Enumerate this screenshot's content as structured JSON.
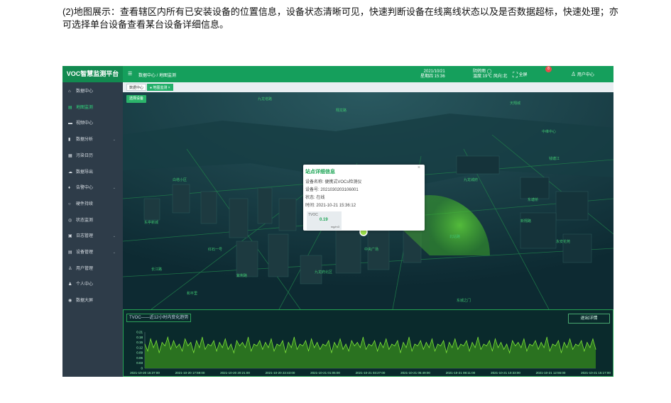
{
  "caption": "(2)地图展示：查看辖区内所有已安装设备的位置信息，设备状态清晰可见，快速判断设备在线离线状态以及是否数据超标，快速处理；亦可选择单台设备查看某台设备详细信息。",
  "app": {
    "title": "VOC智慧监测平台",
    "breadcrumb": "数据中心 / 地图监测",
    "date": "2021/10/21",
    "weekday_time": "星期四 15:36",
    "weather_line1": "阴转雨 ◯",
    "weather_line2": "温度:19℃ 风向:北",
    "fullscreen": "全屏",
    "badge_count": "8",
    "user": "用户中心"
  },
  "sidebar": {
    "items": [
      {
        "label": "数据中心",
        "icon": "home-icon",
        "glyph": "⌂",
        "chevron": ""
      },
      {
        "label": "地图监测",
        "icon": "map-icon",
        "glyph": "▤",
        "chevron": ""
      },
      {
        "label": "视频中心",
        "icon": "video-icon",
        "glyph": "▬",
        "chevron": ""
      },
      {
        "label": "数据分析",
        "icon": "bar-chart-icon",
        "glyph": "▮",
        "chevron": "⌄"
      },
      {
        "label": "污染日历",
        "icon": "calendar-icon",
        "glyph": "▦",
        "chevron": ""
      },
      {
        "label": "数据导出",
        "icon": "export-icon",
        "glyph": "☁",
        "chevron": ""
      },
      {
        "label": "告警中心",
        "icon": "alarm-icon",
        "glyph": "♦",
        "chevron": "⌄"
      },
      {
        "label": "硬件持续",
        "icon": "hardware-icon",
        "glyph": "○",
        "chevron": ""
      },
      {
        "label": "状态监测",
        "icon": "status-icon",
        "glyph": "◎",
        "chevron": ""
      },
      {
        "label": "日志管理",
        "icon": "log-icon",
        "glyph": "▣",
        "chevron": "⌄"
      },
      {
        "label": "设备管理",
        "icon": "device-icon",
        "glyph": "▤",
        "chevron": "⌄"
      },
      {
        "label": "用户管理",
        "icon": "users-icon",
        "glyph": "♙",
        "chevron": ""
      },
      {
        "label": "个人中心",
        "icon": "person-icon",
        "glyph": "♟",
        "chevron": ""
      },
      {
        "label": "数据大屏",
        "icon": "screen-icon",
        "glyph": "◉",
        "chevron": ""
      }
    ],
    "active_index": 1
  },
  "tabs": [
    {
      "label": "数据中心"
    },
    {
      "label": "● 地图监测 ×"
    }
  ],
  "map": {
    "select_button": "选择设备",
    "labels": [
      "九龙塔路",
      "天翔城",
      "翔龙路",
      "东亭新城",
      "红石一号",
      "钱塘江",
      "中维中心",
      "长江路",
      "九龙城府",
      "新翔路",
      "白塔小区",
      "永安花苑",
      "紫荆路",
      "九龙府北区",
      "中央广场",
      "东塘桥",
      "北站路",
      "和平里",
      "东城之门"
    ]
  },
  "popup": {
    "title": "站点详细信息",
    "device_name": "设备名称: 便携式VOCs检测仪",
    "device_no": "设备号: 2021030203106001",
    "status": "状态: 在线",
    "time": "时间: 2021-10-21 15:36:12",
    "tvoc_name": "TVOC",
    "tvoc_value": "0.19",
    "tvoc_unit": "mg/m3",
    "close": "×"
  },
  "chart_panel": {
    "title": "TVOC——近12小时内变化趋势",
    "exit_button": "退出详情"
  },
  "colors": {
    "brand": "#159f5c",
    "sidebar": "#2e3c49",
    "accent": "#2fd67c",
    "line": "#7de23a",
    "fill": "#2e7a1f"
  },
  "chart_data": {
    "type": "area",
    "title": "",
    "xlabel": "",
    "ylabel": "",
    "ylim": [
      0,
      0.21
    ],
    "yticks": [
      "0.21",
      "0.18",
      "0.15",
      "0.12",
      "0.09",
      "0.06",
      "0.03",
      "0"
    ],
    "x_tick_labels": [
      "2021-10-20 15:37:00",
      "2021-10-20 17:59:00",
      "2021-10-20 20:21:00",
      "2021-10-20 22:43:00",
      "2021-10-21 01:05:00",
      "2021-10-21 03:27:00",
      "2021-10-21 05:49:00",
      "2021-10-21 08:11:00",
      "2021-10-21 10:33:00",
      "2021-10-21 12:55:00",
      "2021-10-21 15:17:00"
    ],
    "grid": false,
    "series": [
      {
        "values": [
          0.14,
          0.1,
          0.17,
          0.12,
          0.16,
          0.09,
          0.15,
          0.13,
          0.18,
          0.11,
          0.16,
          0.12,
          0.14,
          0.1,
          0.17,
          0.13,
          0.15,
          0.09,
          0.16,
          0.12,
          0.18,
          0.11,
          0.14,
          0.13,
          0.16,
          0.1,
          0.15,
          0.12,
          0.17,
          0.11,
          0.14,
          0.09,
          0.16,
          0.13,
          0.15,
          0.12,
          0.18,
          0.1,
          0.14,
          0.13,
          0.16,
          0.11,
          0.15,
          0.12,
          0.17,
          0.1,
          0.14,
          0.13,
          0.16,
          0.09,
          0.15,
          0.12,
          0.18,
          0.11,
          0.14,
          0.13,
          0.16,
          0.1,
          0.17,
          0.12,
          0.15,
          0.11,
          0.14,
          0.13,
          0.16,
          0.09,
          0.15,
          0.12,
          0.17,
          0.11,
          0.14,
          0.1,
          0.16,
          0.13,
          0.15,
          0.12,
          0.18,
          0.11,
          0.14,
          0.13,
          0.16,
          0.1,
          0.15,
          0.12,
          0.17,
          0.11,
          0.14,
          0.13,
          0.16,
          0.09,
          0.15,
          0.12,
          0.18,
          0.1,
          0.14,
          0.13,
          0.16,
          0.11,
          0.15,
          0.12,
          0.17,
          0.1,
          0.14,
          0.13,
          0.16,
          0.09,
          0.15,
          0.12,
          0.17,
          0.11,
          0.14,
          0.13,
          0.16,
          0.1,
          0.15,
          0.12,
          0.18,
          0.11,
          0.14,
          0.13,
          0.16,
          0.1,
          0.17,
          0.12,
          0.15,
          0.11,
          0.14,
          0.09,
          0.16,
          0.13,
          0.15,
          0.12,
          0.17,
          0.1,
          0.14,
          0.13,
          0.16,
          0.11,
          0.15,
          0.12,
          0.18,
          0.1,
          0.14,
          0.13,
          0.16,
          0.09,
          0.15,
          0.12,
          0.17,
          0.11,
          0.14,
          0.13,
          0.16,
          0.1,
          0.15,
          0.12,
          0.17,
          0.11
        ]
      }
    ]
  }
}
